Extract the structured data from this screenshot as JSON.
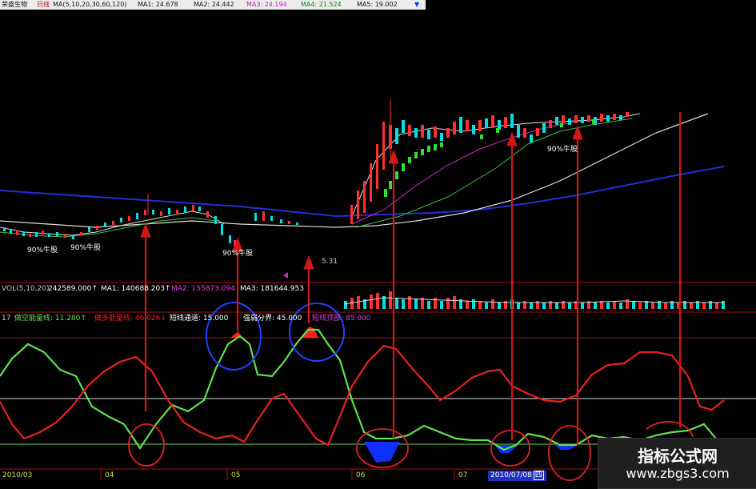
{
  "header": {
    "stock_name": "荣盛生物",
    "period": "日线",
    "ma_label": "MA(5,10,20,30,60,120)",
    "ma1": "MA1: 24.678",
    "ma2": "MA2: 24.442",
    "ma3": "MA3: 24.194",
    "ma4": "MA4: 21.524",
    "ma5": "MA5: 19.002"
  },
  "annotations": {
    "bull_label_1": "90%牛股",
    "bull_label_2": "90%牛股",
    "bull_label_3": "90%牛股",
    "bull_label_4": "90%牛股",
    "price_fragment": "5.31"
  },
  "volume_panel": {
    "title": "VOL(5,10,20)",
    "vol": "242589.000↑",
    "ma1": "MA1: 140688.203↑",
    "ma2": "MA2: 155873.094",
    "ma3": "MA3: 181644.953"
  },
  "indicator_panel": {
    "id": "17",
    "short_energy": "做空能量线: 11.280↑",
    "long_energy": "做多能量线: 46.026↓",
    "short_channel": "短线通道: 15.000",
    "divide": "强弱分界: 45.000",
    "overbought": "短线顶部: 85.000"
  },
  "timeline": {
    "d1": "2010/03",
    "d2": "04",
    "d3": "05",
    "d4": "06",
    "d5": "07",
    "d6": "2010/07/08",
    "d7": "四"
  },
  "watermark": {
    "line1": "指标公式网",
    "line2": "www.zbgs3.com"
  },
  "colors": {
    "up_candle": "#ff3030",
    "down_candle": "#00e0e0",
    "long_energy_line": "#e82020",
    "short_energy_line": "#60e050",
    "arrow": "#d01818",
    "circle": "#2040ff",
    "blue_fill": "#1030ff"
  }
}
